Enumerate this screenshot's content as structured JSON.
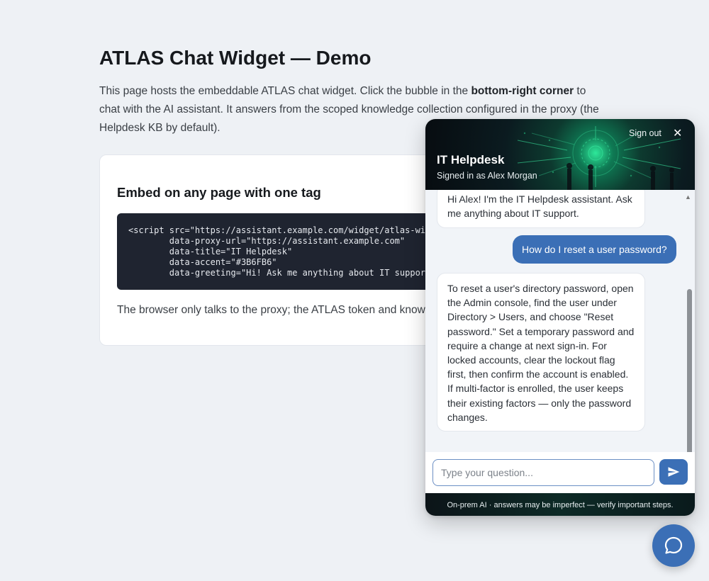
{
  "page": {
    "title": "ATLAS Chat Widget — Demo",
    "intro_before": "This page hosts the embeddable ATLAS chat widget. Click the bubble in the ",
    "intro_bold": "bottom-right corner",
    "intro_after": " to chat with the AI assistant. It answers from the scoped knowledge collection configured in the proxy (the Helpdesk KB by default).",
    "card": {
      "title": "Embed on any page with one tag",
      "code_lines": [
        "<script src=\"https://assistant.example.com/widget/atlas-widget.js\"",
        "        data-proxy-url=\"https://assistant.example.com\"",
        "        data-title=\"IT Helpdesk\"",
        "        data-accent=\"#3B6FB6\"",
        "        data-greeting=\"Hi! Ask me anything about IT support.\">"
      ],
      "note": "The browser only talks to the proxy; the ATLAS token and knowledge base stay on the server."
    }
  },
  "widget": {
    "accent": "#3B6FB6",
    "title": "IT Helpdesk",
    "subtitle": "Signed in as Alex Morgan",
    "signout_label": "Sign out",
    "close_label": "✕",
    "messages": [
      {
        "role": "assistant",
        "text": "Hi Alex! I'm the IT Helpdesk assistant. Ask me anything about IT support."
      },
      {
        "role": "user",
        "text": "How do I reset a user password?"
      },
      {
        "role": "assistant",
        "text": "To reset a user's directory password, open the Admin console, find the user under Directory > Users, and choose \"Reset password.\" Set a temporary password and require a change at next sign-in. For locked accounts, clear the lockout flag first, then confirm the account is enabled. If multi-factor is enrolled, the user keeps their existing factors — only the password changes."
      }
    ],
    "input_placeholder": "Type your question...",
    "input_value": "",
    "send_icon": "send-icon",
    "footer": "On-prem AI · answers may be imperfect — verify important steps."
  },
  "launcher": {
    "icon": "chat-bubble-icon"
  }
}
